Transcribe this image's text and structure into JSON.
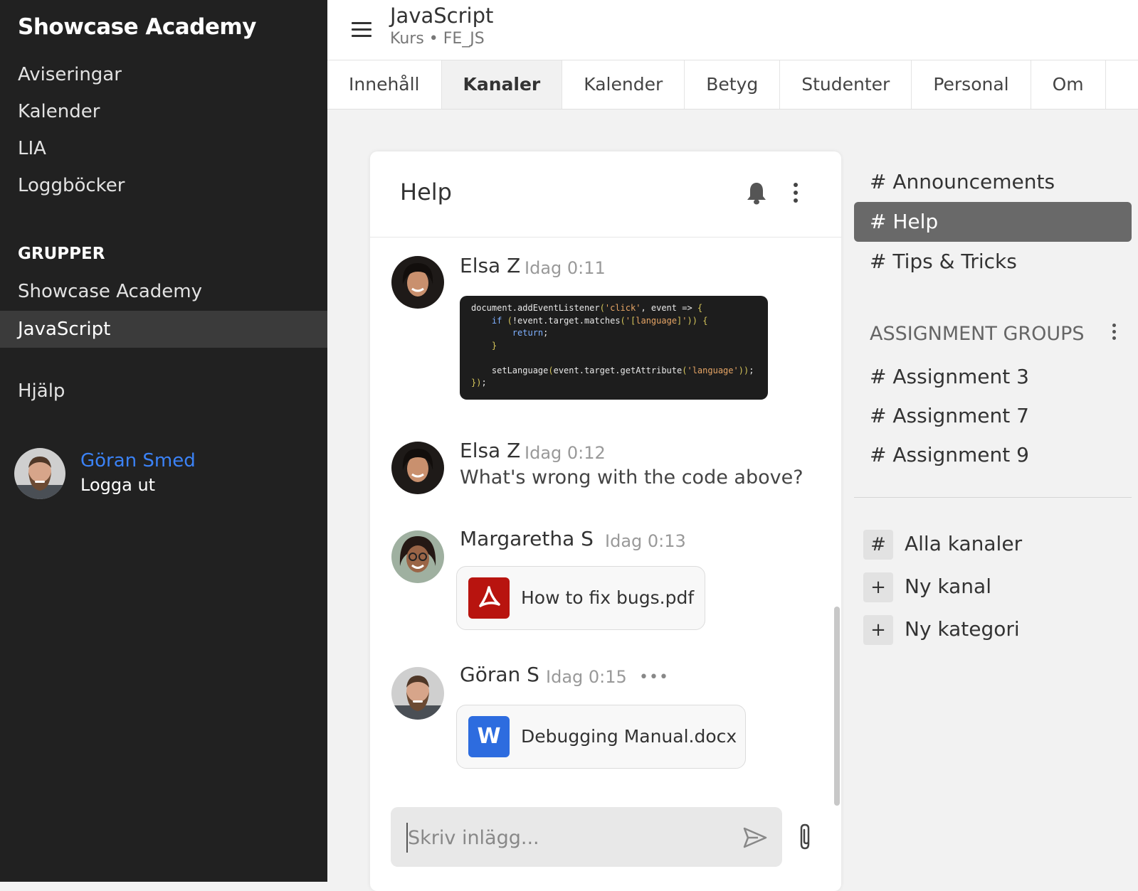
{
  "sidebar": {
    "brand": "Showcase Academy",
    "items": [
      {
        "label": "Aviseringar"
      },
      {
        "label": "Kalender"
      },
      {
        "label": "LIA"
      },
      {
        "label": "Loggböcker"
      }
    ],
    "groups_heading": "GRUPPER",
    "groups": [
      {
        "label": "Showcase Academy"
      },
      {
        "label": "JavaScript"
      }
    ],
    "help": "Hjälp",
    "user": {
      "name": "Göran Smed",
      "logout": "Logga ut"
    }
  },
  "header": {
    "title": "JavaScript",
    "subtitle": "Kurs  •  FE_JS"
  },
  "tabs": [
    {
      "label": "Innehåll"
    },
    {
      "label": "Kanaler"
    },
    {
      "label": "Kalender"
    },
    {
      "label": "Betyg"
    },
    {
      "label": "Studenter"
    },
    {
      "label": "Personal"
    },
    {
      "label": "Om"
    }
  ],
  "active_tab": "Kanaler",
  "channel": {
    "title": "Help",
    "messages": [
      {
        "author": "Elsa Z",
        "time": "Idag 0:11",
        "code": [
          "document.addEventListener('click', event => {",
          "    if (!event.target.matches('[language]')) {",
          "        return;",
          "    }",
          "",
          "    setLanguage(event.target.getAttribute('language'));",
          "});"
        ]
      },
      {
        "author": "Elsa Z",
        "time": "Idag 0:12",
        "text": "What's wrong with the code above?"
      },
      {
        "author": "Margaretha S",
        "time": "Idag 0:13",
        "file": {
          "name": "How to fix bugs.pdf",
          "icon": "pdf-icon",
          "color": "#b8140f"
        }
      },
      {
        "author": "Göran S",
        "time": "Idag 0:15",
        "more": "•••",
        "file": {
          "name": "Debugging Manual.docx",
          "icon": "word-icon",
          "color": "#2d6cdf",
          "letter": "W"
        }
      }
    ],
    "composer_placeholder": "Skriv inlägg..."
  },
  "channels": [
    {
      "label": "# Announcements"
    },
    {
      "label": "# Help",
      "active": true
    },
    {
      "label": "# Tips & Tricks"
    }
  ],
  "assignment_groups": {
    "heading": "ASSIGNMENT GROUPS",
    "items": [
      {
        "label": "# Assignment 3"
      },
      {
        "label": "# Assignment 7"
      },
      {
        "label": "# Assignment 9"
      }
    ]
  },
  "actions": [
    {
      "icon": "#",
      "label": "Alla kanaler"
    },
    {
      "icon": "+",
      "label": "Ny kanal"
    },
    {
      "icon": "+",
      "label": "Ny kategori"
    }
  ],
  "colors": {
    "sidebar_bg": "#212121",
    "accent": "#3b82f6",
    "active_channel": "#696969"
  }
}
